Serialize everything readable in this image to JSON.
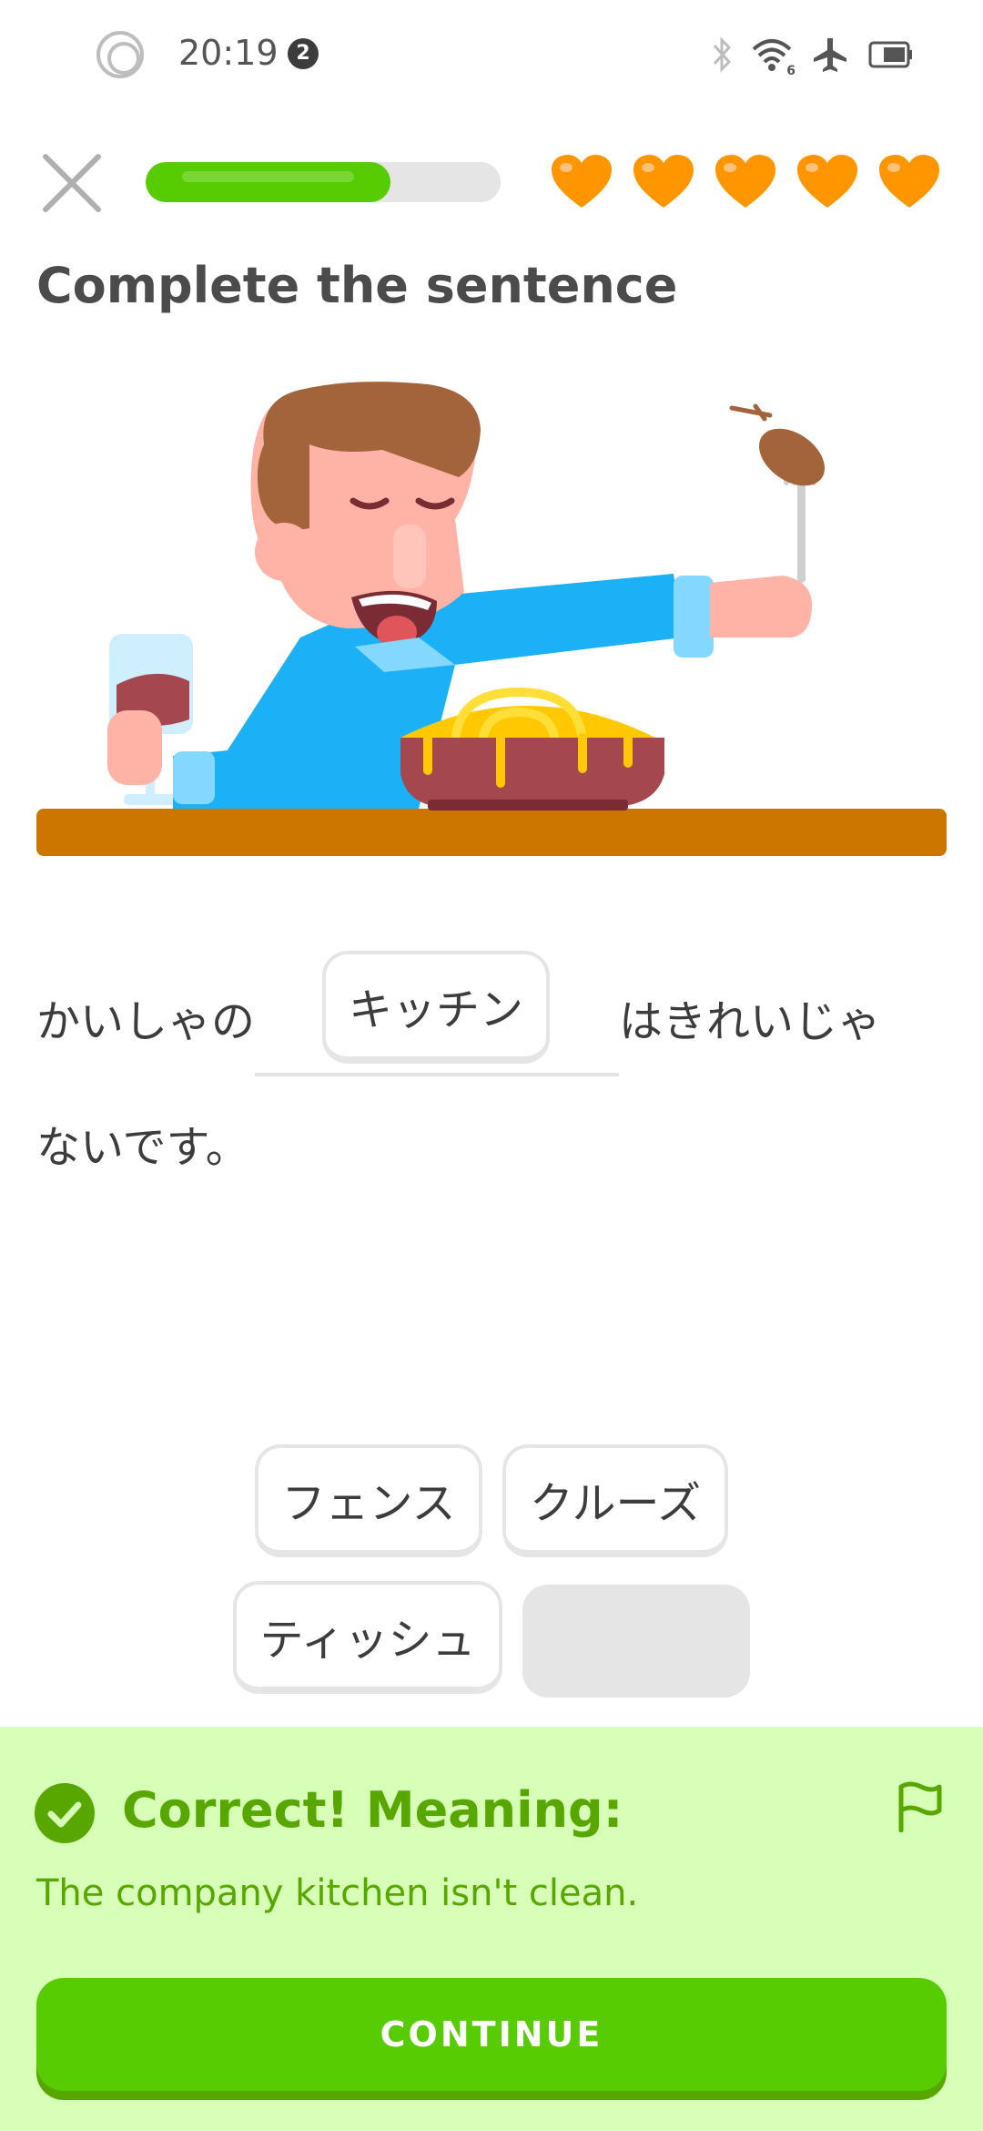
{
  "status_bar": {
    "time": "20:19",
    "notification_count": "2",
    "icons": [
      "record-ring-icon",
      "bluetooth-icon",
      "wifi-icon",
      "airplane-icon",
      "battery-icon"
    ],
    "wifi_label": "6"
  },
  "header": {
    "close_icon": "close-icon",
    "progress": 0.69,
    "hearts": 5,
    "heart_color": "#ff9600"
  },
  "exercise": {
    "title": "Complete the sentence",
    "sentence_part1": "かいしゃの",
    "blank_answer": "キッチン",
    "sentence_part2": "はきれいじゃ",
    "sentence_part3": "ないです。"
  },
  "word_bank": {
    "options": [
      "フェンス",
      "クルーズ",
      "ティッシュ"
    ]
  },
  "feedback": {
    "title": "Correct! Meaning:",
    "meaning": "The company kitchen isn't clean.",
    "continue_label": "CONTINUE",
    "accent": "#58cc02",
    "panel_bg": "#d7ffb8"
  }
}
